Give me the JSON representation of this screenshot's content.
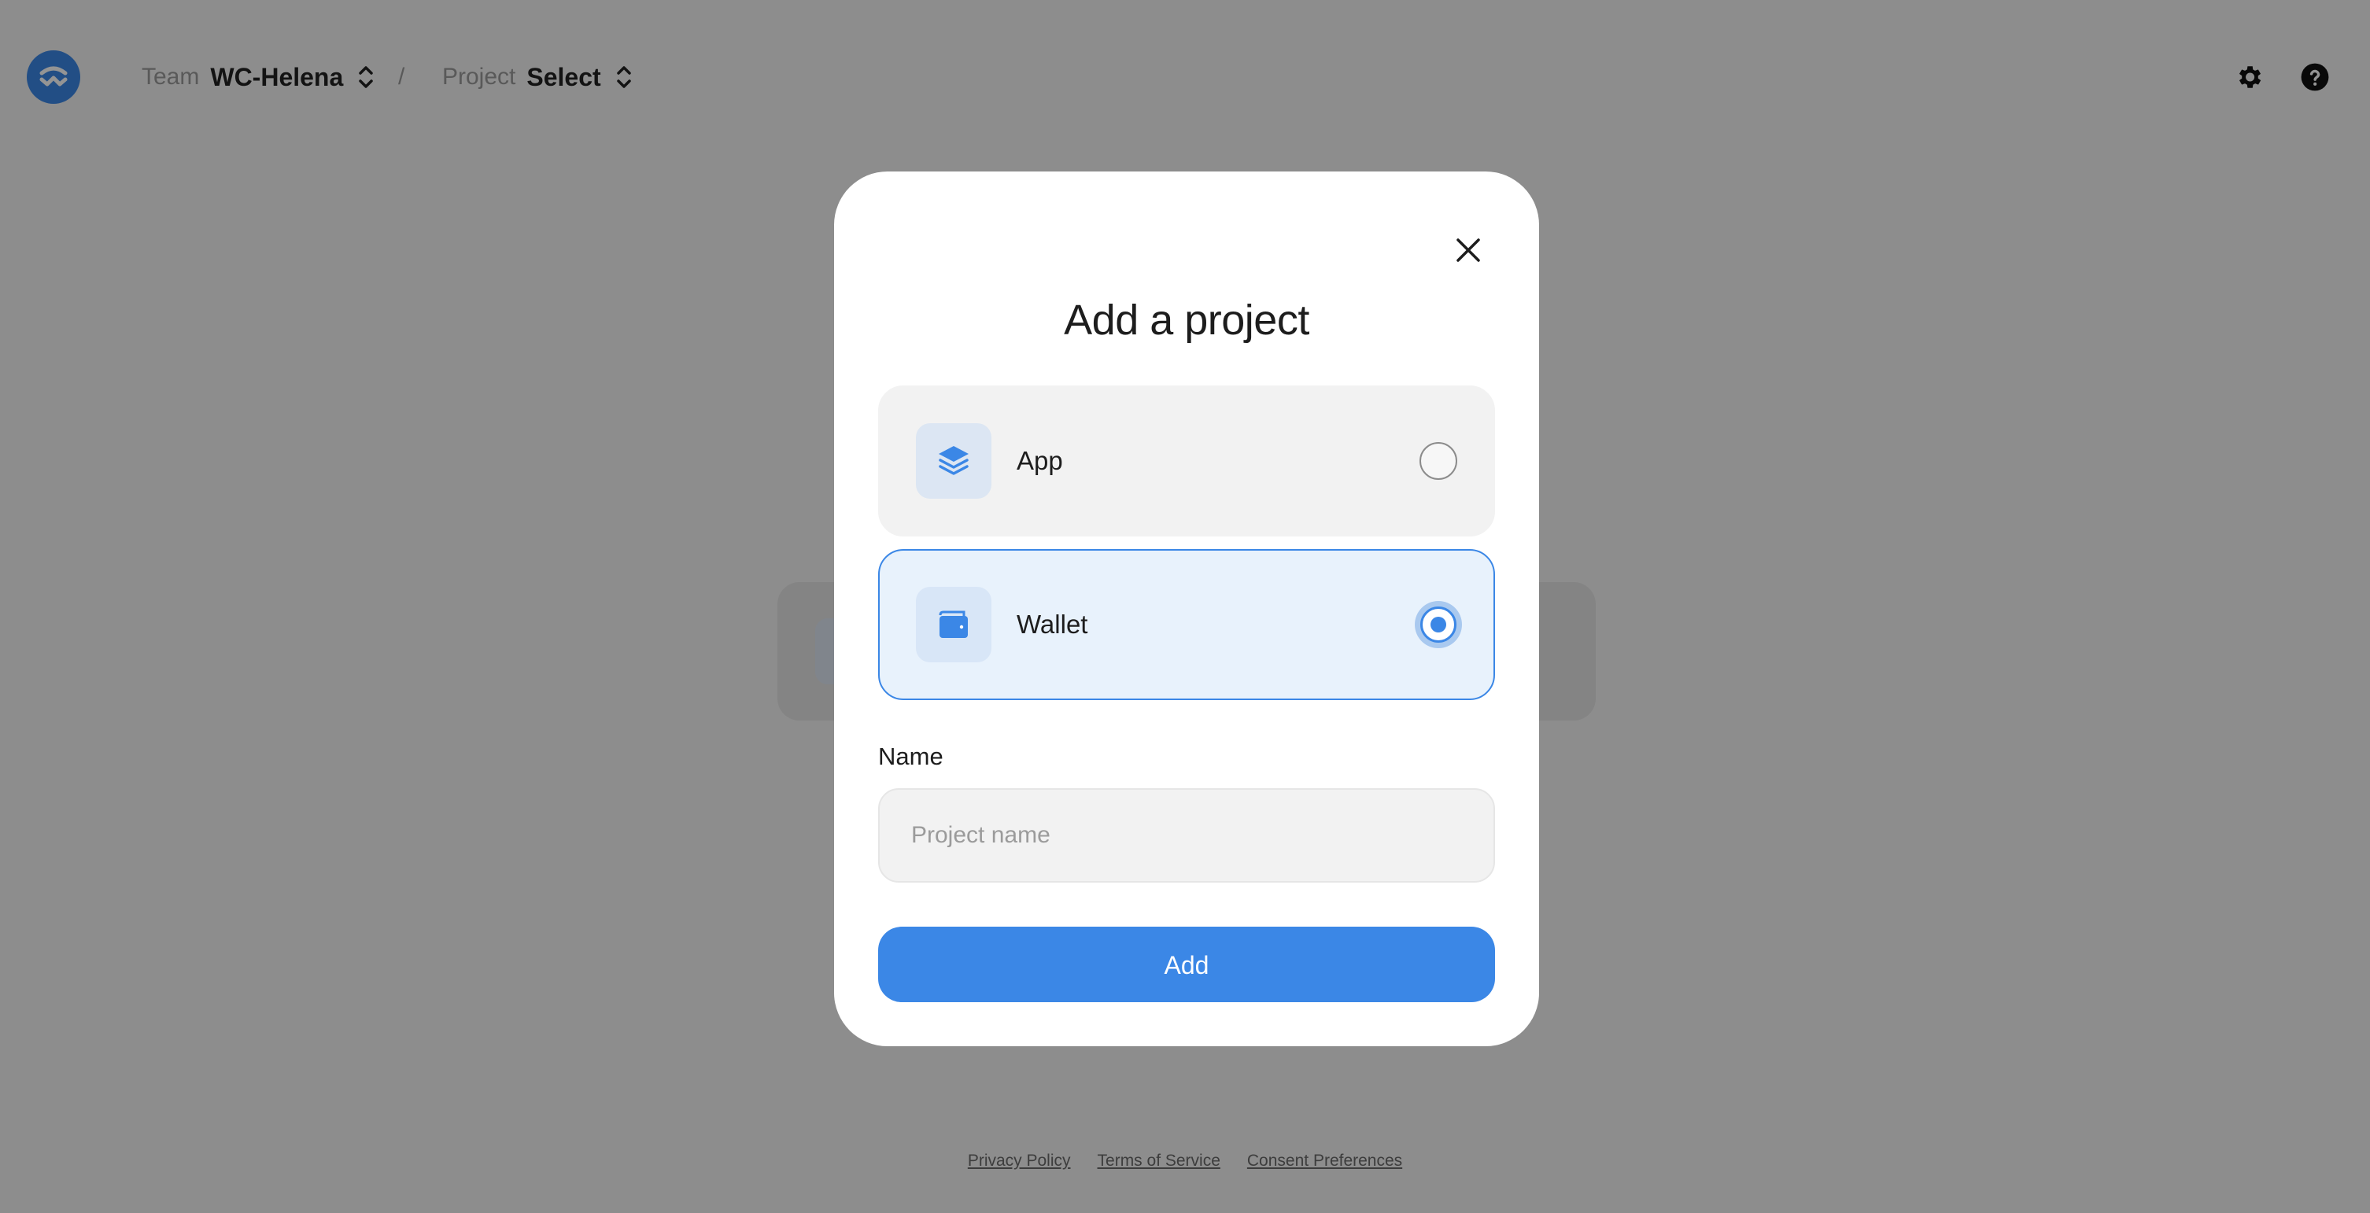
{
  "header": {
    "logo_icon": "walletconnect-logo-icon",
    "team_label": "Team",
    "team_value": "WC-Helena",
    "separator": "/",
    "project_label": "Project",
    "project_value": "Select",
    "settings_icon": "gear-icon",
    "help_icon": "help-icon"
  },
  "modal": {
    "title": "Add a project",
    "close_icon": "close-icon",
    "options": [
      {
        "label": "App",
        "icon": "layers-icon",
        "selected": false
      },
      {
        "label": "Wallet",
        "icon": "wallet-icon",
        "selected": true
      }
    ],
    "name_label": "Name",
    "name_placeholder": "Project name",
    "name_value": "",
    "submit_label": "Add"
  },
  "footer": {
    "links": [
      "Privacy Policy",
      "Terms of Service",
      "Consent Preferences"
    ]
  },
  "colors": {
    "accent": "#3b87e6",
    "overlay": "rgba(0,0,0,0.42)",
    "selected_bg": "#e8f2fc"
  }
}
